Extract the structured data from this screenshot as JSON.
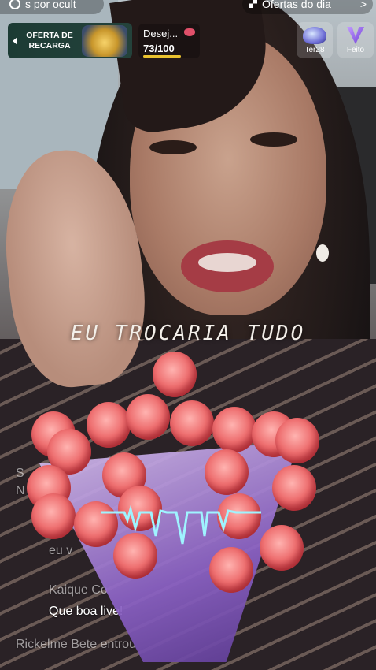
{
  "top_bar": {
    "left_chip_text": "s por ocult",
    "right_chip_text": "Ofertas do dia",
    "right_chip_chevron": ">"
  },
  "recharge_offer": {
    "line1": "OFERTA DE",
    "line2": "RECARGA"
  },
  "wish_goal": {
    "label": "Desej...",
    "count": "73/100",
    "progress": 0.73
  },
  "badges": [
    {
      "label": "Ter28",
      "icon": "planet-icon"
    },
    {
      "label": "Feito",
      "icon": "v-crest-icon"
    }
  ],
  "lyric_text": "EU TROCARIA TUDO",
  "chat": {
    "partial_left_1": "S",
    "partial_left_2": "N",
    "partial_eu": "eu v",
    "user_name": "Kaique Co",
    "message": "Que boa live!",
    "join_notice": "Rickelme Bete entrou"
  },
  "colors": {
    "accent_gold": "#e9c22f",
    "recharge_bg": "#1c3b34",
    "wrap_purple": "#8c62c6",
    "rose_red": "#ee6f70",
    "wave_cyan": "#9ff4ff"
  }
}
